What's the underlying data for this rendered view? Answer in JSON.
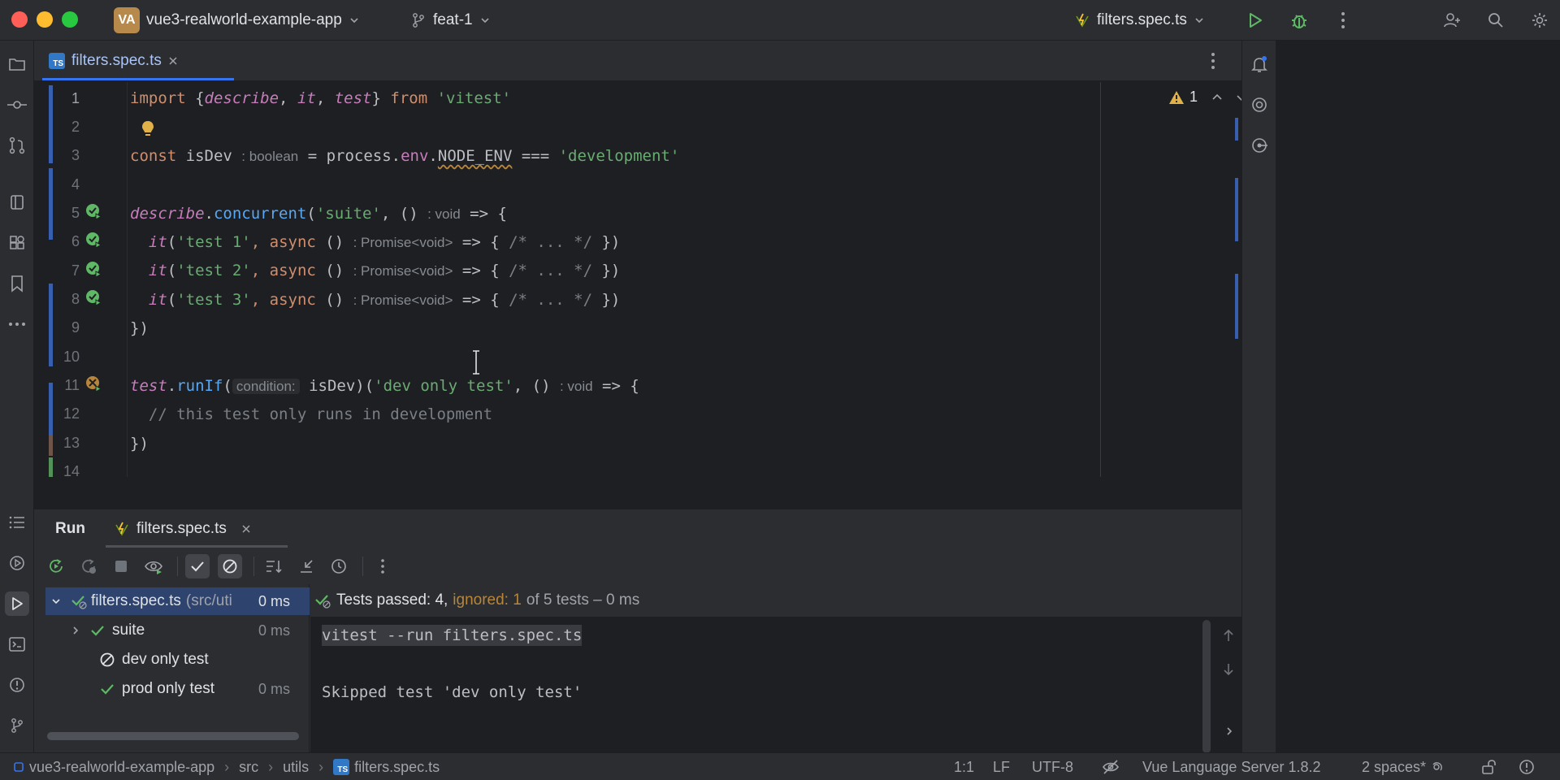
{
  "titlebar": {
    "project_initials": "VA",
    "project_name": "vue3-realworld-example-app",
    "branch": "feat-1",
    "run_config": "filters.spec.ts"
  },
  "editor": {
    "tab_label": "filters.spec.ts",
    "warning_count": "1",
    "line_numbers": [
      "1",
      "2",
      "3",
      "4",
      "5",
      "6",
      "7",
      "8",
      "9",
      "10",
      "11",
      "12",
      "13",
      "14"
    ],
    "code": {
      "l1_import": "import ",
      "l1_brace_open": "{",
      "l1_describe": "describe",
      "l1_comma1": ", ",
      "l1_it": "it",
      "l1_comma2": ", ",
      "l1_test": "test",
      "l1_brace_close": "} ",
      "l1_from": "from ",
      "l1_module": "'vitest'",
      "l3_const": "const ",
      "l3_var": "isDev",
      "l3_hint": ": boolean",
      "l3_eq": " = ",
      "l3_process": "process.",
      "l3_env": "env",
      "l3_dot": ".",
      "l3_nodeenv": "NODE_ENV",
      "l3_cmp": " === ",
      "l3_str": "'development'",
      "l5_describe": "describe",
      "l5_dot": ".",
      "l5_concurrent": "concurrent",
      "l5_open": "(",
      "l5_str": "'suite'",
      "l5_rest": ", () ",
      "l5_hint": ": void",
      "l5_arrow": " => {",
      "tests": [
        {
          "name": "'test 1'",
          "hint": ": Promise<void>"
        },
        {
          "name": "'test 2'",
          "hint": ": Promise<void>"
        },
        {
          "name": "'test 3'",
          "hint": ": Promise<void>"
        }
      ],
      "it_call": "it",
      "it_open": "(",
      "async_kw": ", async ",
      "parens": "() ",
      "arrow_body": " => { ",
      "body_comment": "/* ... */",
      "close_it": " })",
      "l9": "})",
      "l11_test": "test",
      "l11_dot": ".",
      "l11_runif": "runIf",
      "l11_open": "(",
      "l11_param_hint": "condition:",
      "l11_arg": " isDev)(",
      "l11_str": "'dev only test'",
      "l11_rest": ", () ",
      "l11_hint": ": void",
      "l11_arrow": " => {",
      "l12_comment": "  // this test only runs in development",
      "l13": "})"
    }
  },
  "run_panel": {
    "title": "Run",
    "tab_label": "filters.spec.ts",
    "summary_passed": "Tests passed: 4,",
    "summary_ignored": "ignored: 1",
    "summary_rest": "of 5 tests – 0 ms",
    "tree": [
      {
        "label": "filters.spec.ts",
        "path": "(src/uti",
        "duration": "0 ms",
        "status": "passed"
      },
      {
        "label": "suite",
        "duration": "0 ms",
        "status": "passed"
      },
      {
        "label": "dev only test",
        "duration": "",
        "status": "ignored"
      },
      {
        "label": "prod only test",
        "duration": "0 ms",
        "status": "passed"
      }
    ],
    "console": {
      "command": "vitest --run filters.spec.ts",
      "message": "Skipped test 'dev only test'"
    }
  },
  "statusbar": {
    "breadcrumbs": [
      "vue3-realworld-example-app",
      "src",
      "utils",
      "filters.spec.ts"
    ],
    "position": "1:1",
    "line_sep": "LF",
    "encoding": "UTF-8",
    "language_server": "Vue Language Server 1.8.2",
    "indent": "2 spaces*"
  },
  "colors": {
    "accent": "#3574f0",
    "passed": "#5fb865",
    "ignored": "#b8863b",
    "warning": "#e0b149"
  }
}
